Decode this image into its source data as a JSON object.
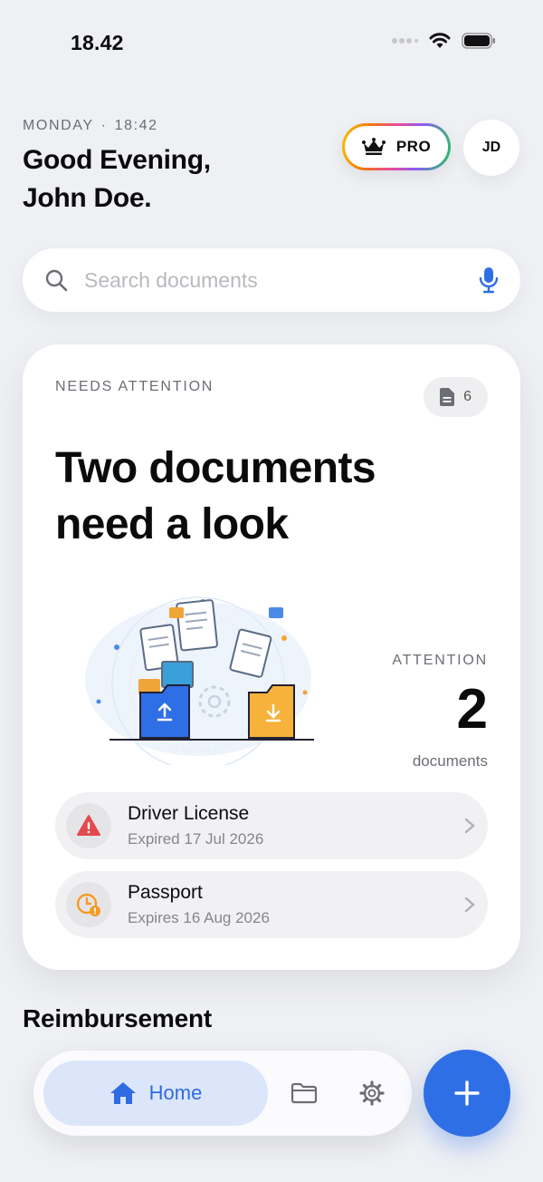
{
  "status_bar": {
    "time": "18.42"
  },
  "header": {
    "day": "MONDAY",
    "separator": "·",
    "time": "18:42",
    "greeting_line1": "Good Evening,",
    "greeting_line2": "John Doe.",
    "pro_label": "PRO",
    "avatar_initials": "JD"
  },
  "search": {
    "placeholder": "Search documents",
    "value": ""
  },
  "attention_card": {
    "label": "NEEDS ATTENTION",
    "doc_count": "6",
    "headline": "Two documents need a look",
    "stat_label": "ATTENTION",
    "stat_value": "2",
    "stat_unit": "documents",
    "items": [
      {
        "title": "Driver License",
        "subtitle": "Expired 17 Jul 2026",
        "status": "expired",
        "icon": "warning-icon",
        "color": "#e5484d"
      },
      {
        "title": "Passport",
        "subtitle": "Expires 16 Aug 2026",
        "status": "expiring",
        "icon": "clock-alert-icon",
        "color": "#f59a23"
      }
    ]
  },
  "section": {
    "title": "Reimbursement"
  },
  "tabbar": {
    "home_label": "Home",
    "tabs": [
      "home-icon",
      "folder-icon",
      "gear-icon"
    ],
    "fab_icon": "plus-icon"
  },
  "colors": {
    "accent": "#2f6fe5",
    "accent_soft": "#dce6fb",
    "danger": "#e5484d",
    "warning": "#f59a23"
  }
}
